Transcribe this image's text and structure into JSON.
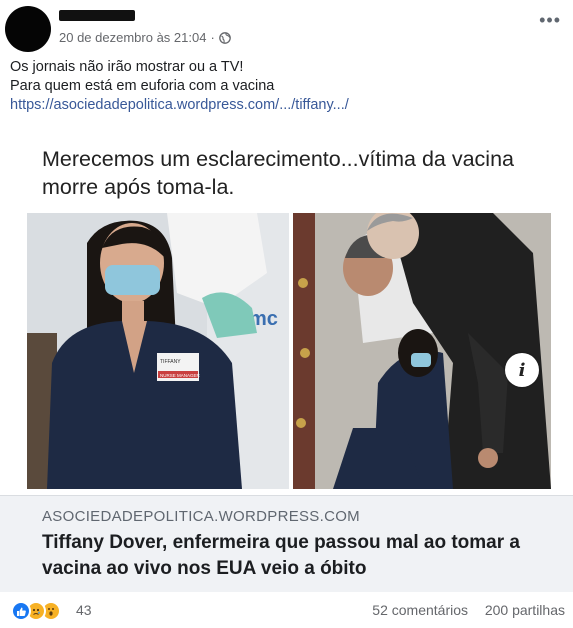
{
  "post": {
    "date": "20 de dezembro às 21:04",
    "audience_icon": "globe-icon",
    "more_label": "•••",
    "text_line_1": "Os jornais não irão mostrar ou a TV!",
    "text_line_2": "Para quem está em euforia com a vacina",
    "link_text": "https://asociedadepolitica.wordpress.com/.../tiffany.../"
  },
  "link_card": {
    "image_headline": "Merecemos um esclarecimento...vítima da vacina morre após toma-la.",
    "info_badge": "i",
    "domain": "ASOCIEDADEPOLITICA.WORDPRESS.COM",
    "title": "Tiffany Dover, enfermeira que passou mal ao tomar a vacina ao vivo nos EUA veio a óbito",
    "photo_texts": {
      "badge_name": "TIFFANY",
      "badge_role": "NURSE MANAGER",
      "wall_text": "mc"
    }
  },
  "reactions": {
    "icons": [
      "like-icon",
      "sad-icon",
      "wow-icon"
    ],
    "count": "43",
    "comments": "52 comentários",
    "shares": "200 partilhas"
  },
  "colors": {
    "link": "#385898",
    "meta": "#65676b",
    "like": "#1877f2",
    "emoji": "#f7b125"
  }
}
